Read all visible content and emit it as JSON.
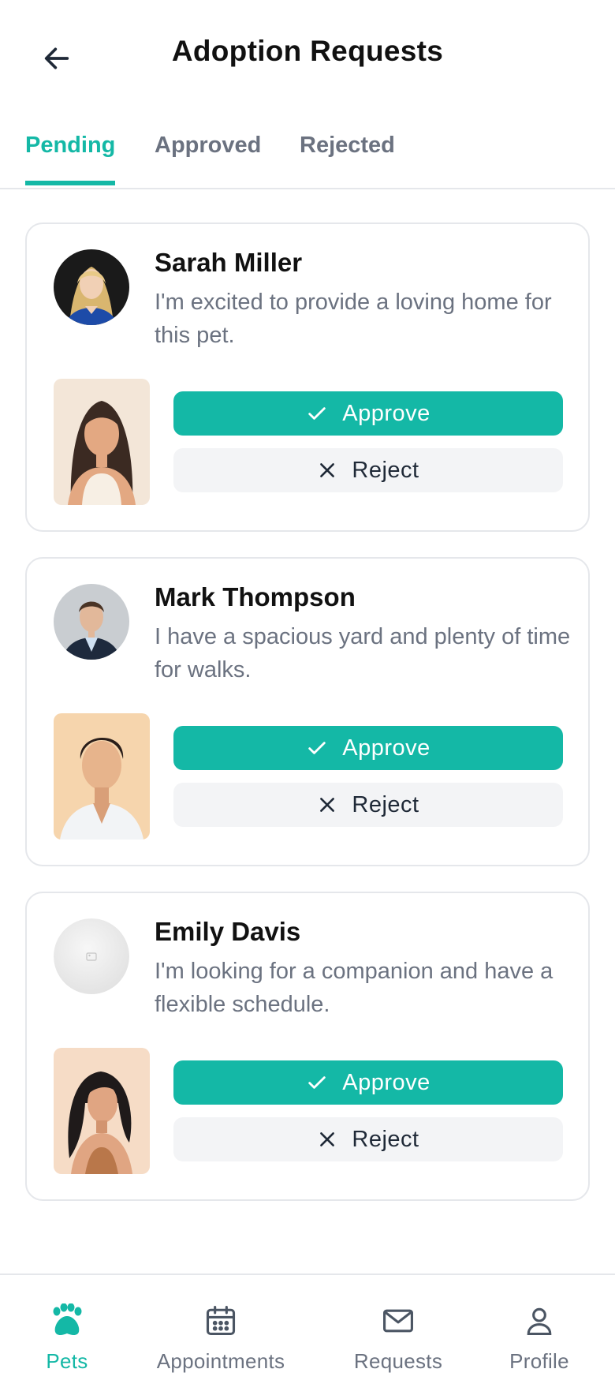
{
  "header": {
    "title": "Adoption Requests",
    "back_icon": "arrow-left-icon"
  },
  "tabs": [
    {
      "label": "Pending",
      "active": true
    },
    {
      "label": "Approved",
      "active": false
    },
    {
      "label": "Rejected",
      "active": false
    }
  ],
  "requests": [
    {
      "name": "Sarah Miller",
      "message": "I'm excited to provide a loving home for this pet.",
      "approve_label": "Approve",
      "reject_label": "Reject"
    },
    {
      "name": "Mark Thompson",
      "message": "I have a spacious yard and plenty of time for walks.",
      "approve_label": "Approve",
      "reject_label": "Reject"
    },
    {
      "name": "Emily Davis",
      "message": "I'm looking for a companion and have a flexible schedule.",
      "approve_label": "Approve",
      "reject_label": "Reject"
    }
  ],
  "bottom_nav": [
    {
      "label": "Pets",
      "icon": "paw-icon",
      "active": true
    },
    {
      "label": "Appointments",
      "icon": "calendar-icon",
      "active": false
    },
    {
      "label": "Requests",
      "icon": "envelope-icon",
      "active": false
    },
    {
      "label": "Profile",
      "icon": "user-icon",
      "active": false
    }
  ],
  "colors": {
    "accent": "#14b8a6",
    "muted_text": "#6b7280",
    "reject_bg": "#f3f4f6",
    "border": "#e5e7eb"
  }
}
